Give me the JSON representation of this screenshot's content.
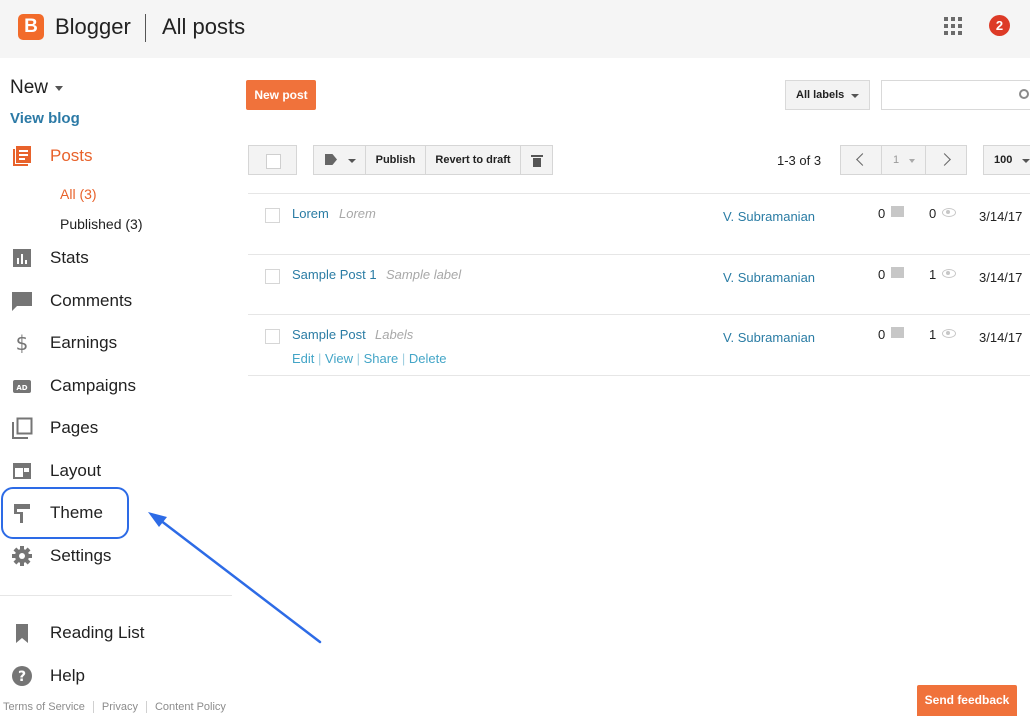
{
  "app": {
    "brand": "Blogger",
    "logo_letter": "B",
    "page_title": "All posts",
    "notification_count": "2",
    "accent": "#f26b2a"
  },
  "sidebar": {
    "new_label": "New",
    "view_blog": "View blog",
    "posts": {
      "label": "Posts",
      "sub": [
        {
          "label": "All (3)"
        },
        {
          "label": "Published (3)"
        }
      ]
    },
    "items": [
      {
        "label": "Stats",
        "icon": "stats-icon"
      },
      {
        "label": "Comments",
        "icon": "comment-icon"
      },
      {
        "label": "Earnings",
        "icon": "dollar-icon"
      },
      {
        "label": "Campaigns",
        "icon": "ad-icon"
      },
      {
        "label": "Pages",
        "icon": "pages-icon"
      },
      {
        "label": "Layout",
        "icon": "layout-icon"
      },
      {
        "label": "Theme",
        "icon": "paint-roller-icon"
      },
      {
        "label": "Settings",
        "icon": "gear-icon"
      }
    ],
    "secondary": [
      {
        "label": "Reading List",
        "icon": "bookmark-icon"
      },
      {
        "label": "Help",
        "icon": "help-icon"
      }
    ],
    "footer_links": [
      "Terms of Service",
      "Privacy",
      "Content Policy"
    ]
  },
  "toolbar": {
    "new_post": "New post",
    "labels_filter": "All labels",
    "search_placeholder": "",
    "publish": "Publish",
    "revert": "Revert to draft",
    "range": "1-3 of 3",
    "page": "1",
    "per_page": "100"
  },
  "posts": [
    {
      "title": "Lorem",
      "label": "Lorem",
      "author": "V. Subramanian",
      "comments": "0",
      "views": "0",
      "date": "3/14/17"
    },
    {
      "title": "Sample Post 1",
      "label": "Sample label",
      "author": "V. Subramanian",
      "comments": "0",
      "views": "1",
      "date": "3/14/17"
    },
    {
      "title": "Sample Post",
      "label": "Labels",
      "author": "V. Subramanian",
      "comments": "0",
      "views": "1",
      "date": "3/14/17"
    }
  ],
  "row_actions": {
    "edit": "Edit",
    "view": "View",
    "share": "Share",
    "delete": "Delete"
  },
  "feedback": "Send feedback",
  "annotation": {
    "color": "#2d6be6"
  }
}
